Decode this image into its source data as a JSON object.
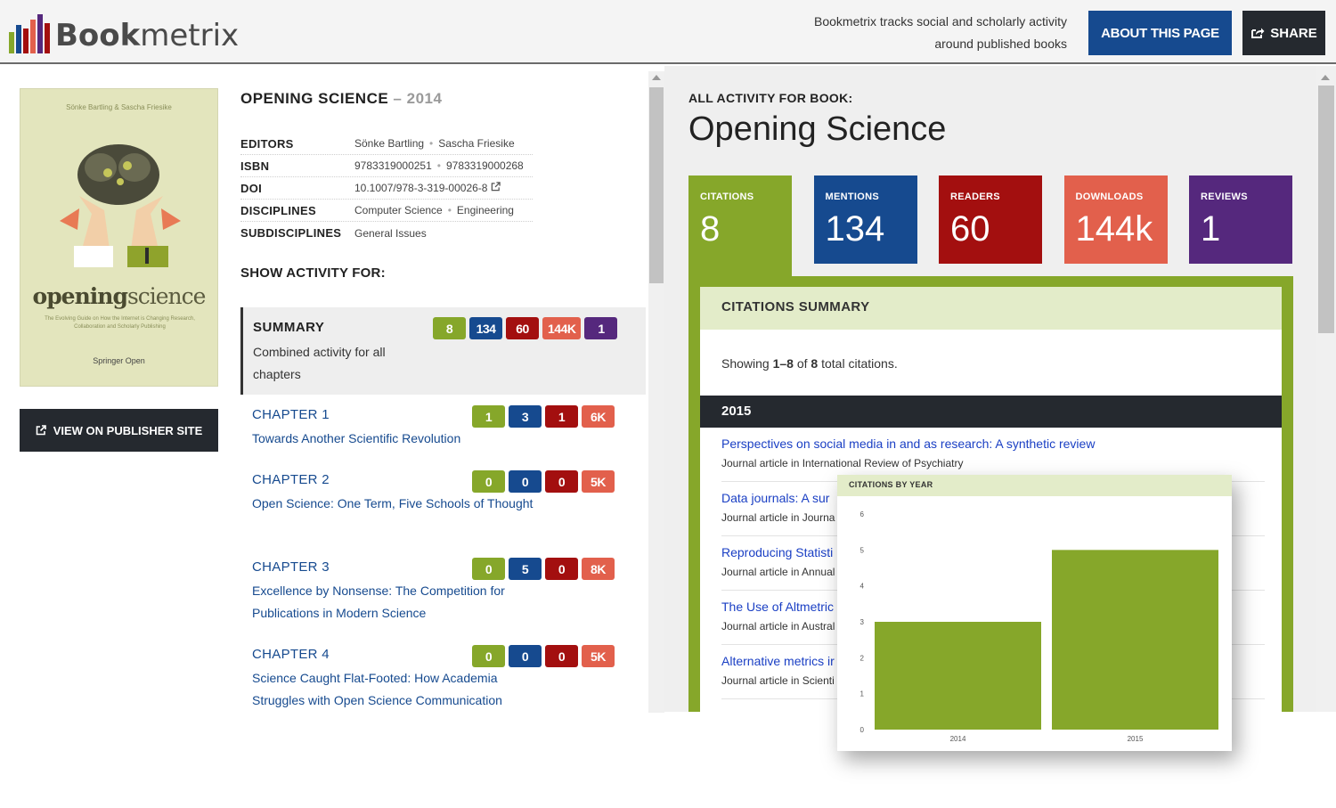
{
  "header": {
    "logo_bold": "Book",
    "logo_light": "metrix",
    "logo_bar_colors": [
      "#86a72a",
      "#164a8f",
      "#a30f0f",
      "#e2604c",
      "#55287d",
      "#a30f0f"
    ],
    "tagline_line1": "Bookmetrix tracks social and scholarly activity",
    "tagline_line2": "around published books",
    "about_label": "ABOUT THIS PAGE",
    "share_label": "SHARE"
  },
  "cover": {
    "authors": "Sönke Bartling & Sascha Friesike",
    "title_part1": "opening",
    "title_part2": "science",
    "subtitle": "The Evolving Guide on How the Internet is Changing Research, Collaboration and Scholarly Publishing",
    "publisher": "Springer Open"
  },
  "publisher_button": "VIEW ON PUBLISHER SITE",
  "book": {
    "title": "OPENING SCIENCE",
    "year": "2014",
    "meta": [
      {
        "key": "EDITORS",
        "values": [
          "Sönke Bartling",
          "Sascha Friesike"
        ]
      },
      {
        "key": "ISBN",
        "values": [
          "9783319000251",
          "9783319000268"
        ]
      },
      {
        "key": "DOI",
        "values": [
          "10.1007/978-3-319-00026-8"
        ]
      },
      {
        "key": "DISCIPLINES",
        "values": [
          "Computer Science",
          "Engineering"
        ]
      },
      {
        "key": "SUBDISCIPLINES",
        "values": [
          "General Issues"
        ]
      }
    ]
  },
  "show_activity_label": "SHOW ACTIVITY FOR:",
  "summary": {
    "title": "SUMMARY",
    "desc": "Combined activity for all chapters",
    "badges": [
      "8",
      "134",
      "60",
      "144K",
      "1"
    ]
  },
  "chapters": [
    {
      "title": "CHAPTER 1",
      "name": "Towards Another Scientific Revolution",
      "badges": [
        "1",
        "3",
        "1",
        "6K"
      ]
    },
    {
      "title": "CHAPTER 2",
      "name": "Open Science: One Term, Five Schools of Thought",
      "badges": [
        "0",
        "0",
        "0",
        "5K"
      ]
    },
    {
      "title": "CHAPTER 3",
      "name": "Excellence by Nonsense: The Competition for Publications in Modern Science",
      "badges": [
        "0",
        "5",
        "0",
        "8K"
      ]
    },
    {
      "title": "CHAPTER 4",
      "name": "Science Caught Flat-Footed: How Academia Struggles with Open Science Communication",
      "badges": [
        "0",
        "0",
        "0",
        "5K"
      ]
    }
  ],
  "colors": {
    "citations": "#86a72a",
    "mentions": "#164a8f",
    "readers": "#a30f0f",
    "downloads": "#e2604c",
    "reviews": "#55287d"
  },
  "activity": {
    "label": "ALL ACTIVITY FOR BOOK:",
    "title": "Opening Science",
    "tiles": [
      {
        "label": "CITATIONS",
        "value": "8"
      },
      {
        "label": "MENTIONS",
        "value": "134"
      },
      {
        "label": "READERS",
        "value": "60"
      },
      {
        "label": "DOWNLOADS",
        "value": "144k"
      },
      {
        "label": "REVIEWS",
        "value": "1"
      }
    ]
  },
  "citations": {
    "header": "CITATIONS SUMMARY",
    "showing_prefix": "Showing ",
    "showing_range": "1–8",
    "showing_of": " of ",
    "showing_total": "8",
    "showing_suffix": " total citations.",
    "year": "2015",
    "source_prefix": "Journal article in ",
    "items": [
      {
        "title": "Perspectives on social media in and as research: A synthetic review",
        "source": "International Review of Psychiatry"
      },
      {
        "title": "Data journals: A sur",
        "source": "Journa"
      },
      {
        "title": "Reproducing Statisti",
        "source": "Annual"
      },
      {
        "title": "The Use of Altmetric",
        "source": "Austral"
      },
      {
        "title": "Alternative metrics ir",
        "source": "Scienti"
      }
    ]
  },
  "chart_data": {
    "type": "bar",
    "title": "CITATIONS BY YEAR",
    "categories": [
      "2014",
      "2015"
    ],
    "values": [
      3,
      5
    ],
    "ylim": [
      0,
      6
    ],
    "yticks": [
      "0",
      "1",
      "2",
      "3",
      "4",
      "5",
      "6"
    ],
    "color": "#86a72a",
    "grid": false
  }
}
